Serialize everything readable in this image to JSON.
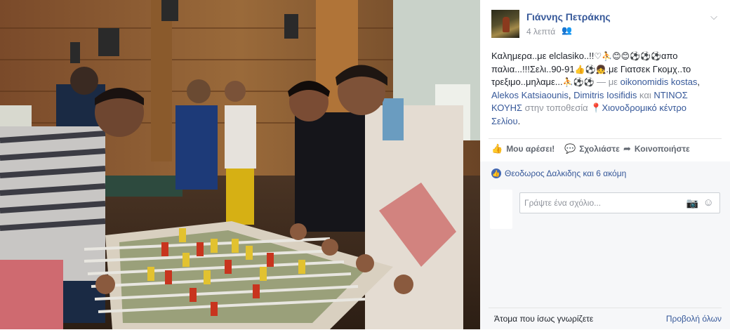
{
  "post": {
    "author": "Γιάννης Πετράκης",
    "time": "4 λεπτά",
    "audience_icon": "friends-icon",
    "text": {
      "part1": "Καλημερα..με elclasiko..!!",
      "emoji1": "♡⛹😊😊⚽⚽⚽",
      "part2": "απο παλια...!!!Σελι..90-91",
      "emoji2": "👍⚽👧",
      "part3": ".με Γιατσεκ Γκομχ..το τρεξιμο..μηλαμε...",
      "emoji3": "⛹⚽⚽",
      "with_sep": " — με ",
      "tag1": "oikonomidis kostas",
      "comma": ", ",
      "tag2": "Alekos Katsiaounis",
      "comma2": ", ",
      "tag3": "Dimitris Iosifidis",
      "and": " και ",
      "tag4": "ΝΤΙΝΟΣ ΚΟΥΗΣ",
      "at": " στην τοποθεσία ",
      "location": "Χιονοδρομικό κέντρο Σελίου",
      "end": "."
    }
  },
  "actions": {
    "like": "Μου αρέσει!",
    "comment": "Σχολιάστε",
    "share": "Κοινοποιήστε"
  },
  "reactions": {
    "names": "Θεοδωρος Δαλκιδης και 6 ακόμη"
  },
  "comment_input": {
    "placeholder": "Γράψτε ένα σχόλιο..."
  },
  "suggestions": {
    "title": "Άτομα που ίσως γνωρίζετε",
    "link": "Προβολή όλων"
  },
  "colors": {
    "link": "#365899",
    "muted": "#90949c",
    "like_blue": "#4267b2"
  }
}
